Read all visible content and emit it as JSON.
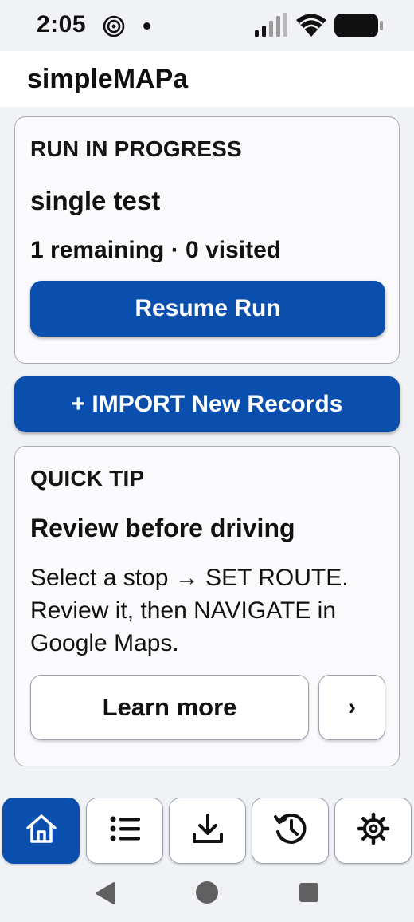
{
  "status_bar": {
    "time": "2:05",
    "icons": [
      "at-sign-icon",
      "notification-dot-icon",
      "cell-signal-icon",
      "wifi-icon",
      "battery-icon"
    ]
  },
  "app": {
    "title": "simpleMAPa"
  },
  "run_card": {
    "eyebrow": "RUN IN PROGRESS",
    "run_name": "single test",
    "progress_text": "1 remaining · 0 visited",
    "resume_label": "Resume Run"
  },
  "import_button": {
    "label": "+ IMPORT New Records"
  },
  "tip_card": {
    "eyebrow": "QUICK TIP",
    "headline": "Review before driving",
    "body": "Select a stop → SET ROUTE. Review it, then NAVIGATE in Google Maps.",
    "learn_more_label": "Learn more",
    "next_label": "›"
  },
  "bottom_nav": {
    "items": [
      {
        "icon": "home-icon",
        "active": true
      },
      {
        "icon": "list-icon",
        "active": false
      },
      {
        "icon": "download-icon",
        "active": false
      },
      {
        "icon": "history-icon",
        "active": false
      },
      {
        "icon": "gear-icon",
        "active": false
      }
    ]
  },
  "colors": {
    "primary": "#0b4fae",
    "background": "#f1f2f6",
    "card": "#fafafd",
    "text": "#111111"
  }
}
